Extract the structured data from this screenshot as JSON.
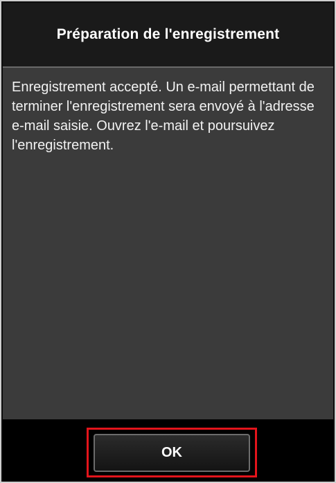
{
  "dialog": {
    "title": "Préparation de l'enregistrement",
    "message": "Enregistrement accepté. Un e-mail permettant de terminer l'enregistrement sera envoyé à l'adresse e-mail saisie. Ouvrez l'e-mail et poursuivez l'enregistrement.",
    "ok_label": "OK"
  },
  "colors": {
    "background": "#0d0d0d",
    "content_background": "#3b3b3b",
    "highlight": "#e3141b",
    "text": "#ffffff"
  }
}
